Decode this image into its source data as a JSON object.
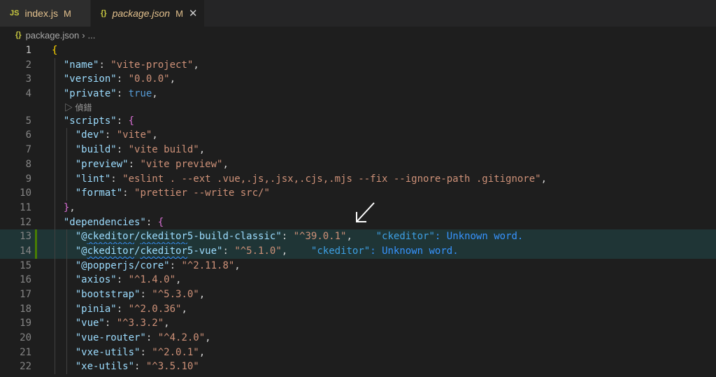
{
  "tabs": [
    {
      "icon": "JS",
      "label": "index.js",
      "modified": "M",
      "active": false
    },
    {
      "icon": "{}",
      "label": "package.json",
      "modified": "M",
      "active": true,
      "close": "✕"
    }
  ],
  "breadcrumb": {
    "icon": "{}",
    "file": "package.json",
    "sep": "›",
    "more": "..."
  },
  "codelens": {
    "icon": "▷",
    "label": "偵錯"
  },
  "lines": [
    {
      "n": "1",
      "code": [
        [
          "b1",
          "{"
        ]
      ]
    },
    {
      "n": "2",
      "code": [
        [
          "p",
          "  "
        ],
        [
          "k",
          "\"name\""
        ],
        [
          "p",
          ": "
        ],
        [
          "s",
          "\"vite-project\""
        ],
        [
          "p",
          ","
        ]
      ]
    },
    {
      "n": "3",
      "code": [
        [
          "p",
          "  "
        ],
        [
          "k",
          "\"version\""
        ],
        [
          "p",
          ": "
        ],
        [
          "s",
          "\"0.0.0\""
        ],
        [
          "p",
          ","
        ]
      ]
    },
    {
      "n": "4",
      "code": [
        [
          "p",
          "  "
        ],
        [
          "k",
          "\"private\""
        ],
        [
          "p",
          ": "
        ],
        [
          "kw",
          "true"
        ],
        [
          "p",
          ","
        ]
      ]
    },
    {
      "n": "5",
      "code": [
        [
          "p",
          "  "
        ],
        [
          "k",
          "\"scripts\""
        ],
        [
          "p",
          ": "
        ],
        [
          "b2",
          "{"
        ]
      ]
    },
    {
      "n": "6",
      "code": [
        [
          "p",
          "    "
        ],
        [
          "k",
          "\"dev\""
        ],
        [
          "p",
          ": "
        ],
        [
          "s",
          "\"vite\""
        ],
        [
          "p",
          ","
        ]
      ]
    },
    {
      "n": "7",
      "code": [
        [
          "p",
          "    "
        ],
        [
          "k",
          "\"build\""
        ],
        [
          "p",
          ": "
        ],
        [
          "s",
          "\"vite build\""
        ],
        [
          "p",
          ","
        ]
      ]
    },
    {
      "n": "8",
      "code": [
        [
          "p",
          "    "
        ],
        [
          "k",
          "\"preview\""
        ],
        [
          "p",
          ": "
        ],
        [
          "s",
          "\"vite preview\""
        ],
        [
          "p",
          ","
        ]
      ]
    },
    {
      "n": "9",
      "code": [
        [
          "p",
          "    "
        ],
        [
          "k",
          "\"lint\""
        ],
        [
          "p",
          ": "
        ],
        [
          "s",
          "\"eslint . --ext .vue,.js,.jsx,.cjs,.mjs --fix --ignore-path .gitignore\""
        ],
        [
          "p",
          ","
        ]
      ]
    },
    {
      "n": "10",
      "code": [
        [
          "p",
          "    "
        ],
        [
          "k",
          "\"format\""
        ],
        [
          "p",
          ": "
        ],
        [
          "s",
          "\"prettier --write src/\""
        ]
      ]
    },
    {
      "n": "11",
      "code": [
        [
          "p",
          "  "
        ],
        [
          "b2",
          "}"
        ],
        [
          "p",
          ","
        ]
      ]
    },
    {
      "n": "12",
      "code": [
        [
          "p",
          "  "
        ],
        [
          "k",
          "\"dependencies\""
        ],
        [
          "p",
          ": "
        ],
        [
          "b2",
          "{"
        ]
      ]
    },
    {
      "n": "13",
      "hl": true,
      "code": [
        [
          "p",
          "    "
        ],
        [
          "k",
          "\"@"
        ],
        [
          "ksq",
          "ckeditor"
        ],
        [
          "k",
          "/"
        ],
        [
          "ksq",
          "ckeditor"
        ],
        [
          "k",
          "5-build-classic\""
        ],
        [
          "p",
          ": "
        ],
        [
          "s",
          "\"^39.0.1\""
        ],
        [
          "p",
          ","
        ]
      ],
      "diag": {
        "word": "\"ckeditor\"",
        "msg": ": Unknown word."
      }
    },
    {
      "n": "14",
      "hl": true,
      "code": [
        [
          "p",
          "    "
        ],
        [
          "k",
          "\"@"
        ],
        [
          "ksq",
          "ckeditor"
        ],
        [
          "k",
          "/"
        ],
        [
          "ksq",
          "ckeditor"
        ],
        [
          "k",
          "5-vue\""
        ],
        [
          "p",
          ": "
        ],
        [
          "s",
          "\"^5.1.0\""
        ],
        [
          "p",
          ","
        ]
      ],
      "diag": {
        "word": "\"ckeditor\"",
        "msg": ": Unknown word."
      }
    },
    {
      "n": "15",
      "code": [
        [
          "p",
          "    "
        ],
        [
          "k",
          "\"@popperjs/core\""
        ],
        [
          "p",
          ": "
        ],
        [
          "s",
          "\"^2.11.8\""
        ],
        [
          "p",
          ","
        ]
      ]
    },
    {
      "n": "16",
      "code": [
        [
          "p",
          "    "
        ],
        [
          "k",
          "\"axios\""
        ],
        [
          "p",
          ": "
        ],
        [
          "s",
          "\"^1.4.0\""
        ],
        [
          "p",
          ","
        ]
      ]
    },
    {
      "n": "17",
      "code": [
        [
          "p",
          "    "
        ],
        [
          "k",
          "\"bootstrap\""
        ],
        [
          "p",
          ": "
        ],
        [
          "s",
          "\"^5.3.0\""
        ],
        [
          "p",
          ","
        ]
      ]
    },
    {
      "n": "18",
      "code": [
        [
          "p",
          "    "
        ],
        [
          "k",
          "\"pinia\""
        ],
        [
          "p",
          ": "
        ],
        [
          "s",
          "\"^2.0.36\""
        ],
        [
          "p",
          ","
        ]
      ]
    },
    {
      "n": "19",
      "code": [
        [
          "p",
          "    "
        ],
        [
          "k",
          "\"vue\""
        ],
        [
          "p",
          ": "
        ],
        [
          "s",
          "\"^3.3.2\""
        ],
        [
          "p",
          ","
        ]
      ]
    },
    {
      "n": "20",
      "code": [
        [
          "p",
          "    "
        ],
        [
          "k",
          "\"vue-router\""
        ],
        [
          "p",
          ": "
        ],
        [
          "s",
          "\"^4.2.0\""
        ],
        [
          "p",
          ","
        ]
      ]
    },
    {
      "n": "21",
      "code": [
        [
          "p",
          "    "
        ],
        [
          "k",
          "\"vxe-utils\""
        ],
        [
          "p",
          ": "
        ],
        [
          "s",
          "\"^2.0.1\""
        ],
        [
          "p",
          ","
        ]
      ]
    },
    {
      "n": "22",
      "code": [
        [
          "p",
          "    "
        ],
        [
          "k",
          "\"xe-utils\""
        ],
        [
          "p",
          ": "
        ],
        [
          "s",
          "\"^3.5.10\""
        ]
      ]
    }
  ],
  "colors": {
    "accent": "#3794ff",
    "key": "#9cdcfe",
    "string": "#ce9178",
    "keyword": "#569cd6",
    "bracket1": "#ffd700",
    "bracket2": "#da70d6",
    "modified": "#e2c08d"
  }
}
